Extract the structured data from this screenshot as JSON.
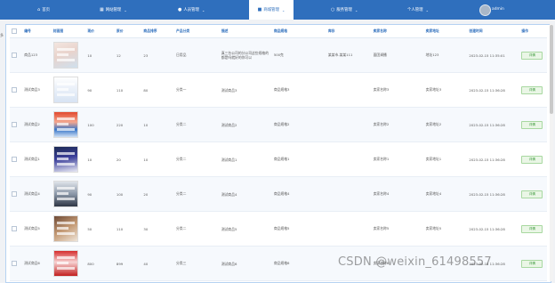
{
  "nav": {
    "items": [
      {
        "label": "首页",
        "icon": "home-icon",
        "has_menu": false
      },
      {
        "label": "网站管理",
        "icon": "grid-icon",
        "has_menu": true
      },
      {
        "label": "人员管理",
        "icon": "user-icon",
        "has_menu": true
      },
      {
        "label": "商城管理",
        "icon": "shop-icon",
        "has_menu": true,
        "active": true
      },
      {
        "label": "服务管理",
        "icon": "chat-icon",
        "has_menu": true
      },
      {
        "label": "个人管理",
        "icon": "profile-icon",
        "has_menu": true
      }
    ],
    "user": "admin"
  },
  "table": {
    "columns": [
      "编号",
      "封面图",
      "现价",
      "原价",
      "商品排序",
      "产品分类",
      "描述",
      "商品规格",
      "库存",
      "卖家名称",
      "卖家地址",
      "创建时间",
      "操作"
    ],
    "rows": [
      {
        "id": "商品123",
        "thumb": "th-a",
        "price": "10",
        "orig": "12",
        "sort": "23",
        "cat": "日用品",
        "desc": "真三台公司的分公司这些规格的都是吗就好的你可以",
        "spec": "500克",
        "stock": "某某市-某某111",
        "seller": "面团调播",
        "addr": "地址123",
        "time": "2023-02-15 11:35:01",
        "action": "详情"
      },
      {
        "id": "测试商品3",
        "thumb": "th-b",
        "price": "90",
        "orig": "110",
        "sort": "80",
        "cat": "分类一",
        "desc": "测试商品3",
        "spec": "商品规格3",
        "stock": "",
        "seller": "卖家名称3",
        "addr": "卖家地址3",
        "time": "2023-02-15 11:36:28",
        "action": "详情"
      },
      {
        "id": "测试商品2",
        "thumb": "th-c",
        "price": "100",
        "orig": "220",
        "sort": "10",
        "cat": "分类二",
        "desc": "测试商品2",
        "spec": "商品规格2",
        "stock": "",
        "seller": "卖家名称2",
        "addr": "卖家地址2",
        "time": "2023-02-15 11:36:28",
        "action": "详情"
      },
      {
        "id": "测试商品1",
        "thumb": "th-d",
        "price": "10",
        "orig": "20",
        "sort": "10",
        "cat": "分类二",
        "desc": "测试商品1",
        "spec": "商品规格1",
        "stock": "",
        "seller": "卖家名称1",
        "addr": "卖家地址1",
        "time": "2023-02-15 11:36:28",
        "action": "详情"
      },
      {
        "id": "测试商品4",
        "thumb": "th-e",
        "price": "90",
        "orig": "100",
        "sort": "20",
        "cat": "分类二",
        "desc": "测试商品4",
        "spec": "商品规格4",
        "stock": "",
        "seller": "卖家名称4",
        "addr": "卖家地址4",
        "time": "2023-02-15 11:36:28",
        "action": "详情"
      },
      {
        "id": "测试商品5",
        "thumb": "th-f",
        "price": "50",
        "orig": "110",
        "sort": "30",
        "cat": "分类二",
        "desc": "测试商品5",
        "spec": "商品规格5",
        "stock": "",
        "seller": "卖家名称5",
        "addr": "卖家地址5",
        "time": "2023-02-15 11:36:28",
        "action": "详情"
      },
      {
        "id": "测试商品6",
        "thumb": "th-g",
        "price": "800",
        "orig": "899",
        "sort": "40",
        "cat": "分类三",
        "desc": "测试商品6",
        "spec": "商品规格6",
        "stock": "",
        "seller": "卖家名称6",
        "addr": "",
        "time": "2023-02-15 11:36:28",
        "action": "详情"
      }
    ]
  },
  "gutter_mark": "多",
  "watermark": "CSDN @weixin_61498557",
  "colors": {
    "nav": "#2f6fbd",
    "header_text": "#2f6fbd",
    "detail_button": "#eaf6e6"
  }
}
